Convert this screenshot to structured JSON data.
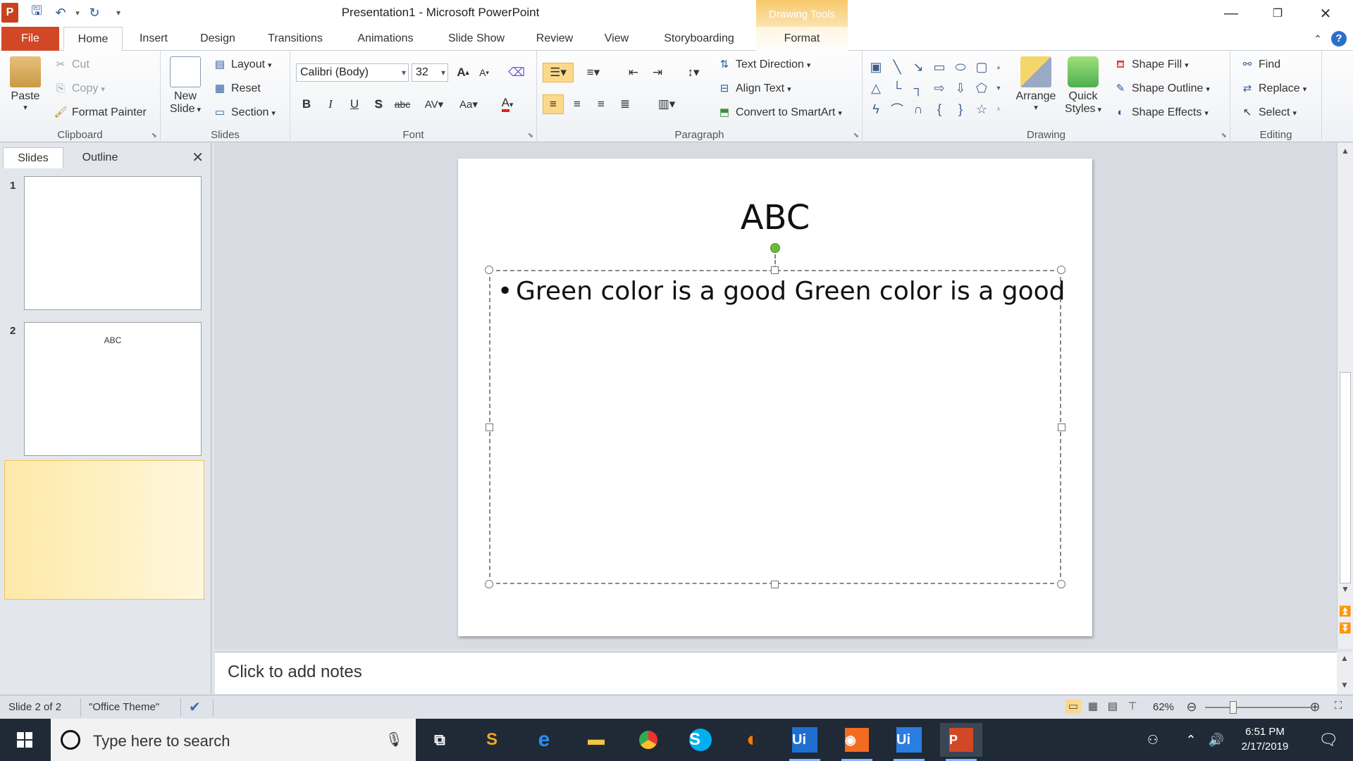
{
  "window": {
    "title": "Presentation1  -  Microsoft PowerPoint",
    "context_tab_title": "Drawing Tools"
  },
  "tabs": [
    "File",
    "Home",
    "Insert",
    "Design",
    "Transitions",
    "Animations",
    "Slide Show",
    "Review",
    "View",
    "Storyboarding",
    "Format"
  ],
  "ribbon": {
    "clipboard": {
      "label": "Clipboard",
      "paste": "Paste",
      "cut": "Cut",
      "copy": "Copy",
      "format_painter": "Format Painter"
    },
    "slides": {
      "label": "Slides",
      "new_slide_1": "New",
      "new_slide_2": "Slide",
      "layout": "Layout",
      "reset": "Reset",
      "section": "Section"
    },
    "font": {
      "label": "Font",
      "font_name": "Calibri (Body)",
      "font_size": "32"
    },
    "paragraph": {
      "label": "Paragraph",
      "text_direction": "Text Direction",
      "align_text": "Align Text",
      "convert_smartart": "Convert to SmartArt"
    },
    "drawing": {
      "label": "Drawing",
      "arrange": "Arrange",
      "quick_styles_1": "Quick",
      "quick_styles_2": "Styles",
      "shape_fill": "Shape Fill",
      "shape_outline": "Shape Outline",
      "shape_effects": "Shape Effects"
    },
    "editing": {
      "label": "Editing",
      "find": "Find",
      "replace": "Replace",
      "select": "Select"
    }
  },
  "left_panel": {
    "tabs": [
      "Slides",
      "Outline"
    ],
    "thumbnails": [
      {
        "number": "1",
        "title": ""
      },
      {
        "number": "2",
        "title": "ABC"
      }
    ]
  },
  "slide": {
    "title": "ABC",
    "bullets": [
      "Green color is a good Green color is a good"
    ]
  },
  "notes": {
    "placeholder": "Click to add notes"
  },
  "status": {
    "slide_info": "Slide 2 of 2",
    "theme": "\"Office Theme\"",
    "zoom": "62%"
  },
  "taskbar": {
    "search_placeholder": "Type here to search",
    "time": "6:51 PM",
    "date": "2/17/2019"
  },
  "colors": {
    "file_tab": "#d24726",
    "context_tab": "#f8c96a",
    "selection": "#fcd98a",
    "taskbar": "#1f2a36"
  }
}
